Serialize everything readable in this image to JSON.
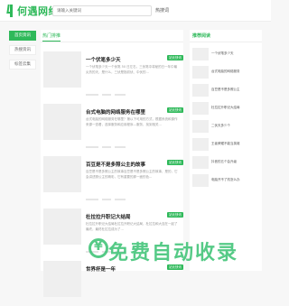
{
  "header": {
    "logo_text": "何遇网络",
    "search_placeholder": "请输入关键词",
    "search_button": "热搜词"
  },
  "sidebar": {
    "items": [
      {
        "label": "首页资讯",
        "active": true
      },
      {
        "label": "热搜资讯",
        "active": false
      },
      {
        "label": "标签云集",
        "active": false
      }
    ]
  },
  "main": {
    "tab": "热门排推",
    "articles": [
      {
        "title": "一个伏笔多少天",
        "badge": "站长快讯",
        "desc": "一个伏笔多少天一个伏笔 50 日左右，三伏笔中将秘的日一年中最炎热的天，是什么，三伏是指初伏、中伏的..."
      },
      {
        "title": "台式电脑的网络服务在哪里",
        "badge": "站长快讯",
        "desc": "台式电脑的网络服务在哪里？第以下可用的方式，根据系统和操作来源一查看，选择服务和应用程序—服务，找到相关..."
      },
      {
        "title": "百豆是不是多照公主的故事",
        "badge": "站长快讯",
        "desc": "百豆是不是多照公主的故事百豆是不是多照公主的故事，是的，它会讲述照公主的精彩，它有重要的那一面的色..."
      },
      {
        "title": "杜拉拉升职记大结局",
        "badge": "站长快讯",
        "desc": "杜拉拉升职记大结局杜拉拉升职记大结局，杜拉拉和大连在一起了最终，最终杜拉拉成为了..."
      },
      {
        "title": "世界杯是一年",
        "badge": "站长快讯",
        "desc": ""
      }
    ]
  },
  "right": {
    "heading": "推荐阅读",
    "items": [
      "一个伏笔多少天",
      "台式电脑的网络服务",
      "百豆是不是多照公主",
      "杜拉拉升职记大结局",
      "二伏天多少个",
      "王者荣耀不能当英雄",
      "抖音的五个会升级",
      "电脑开不了机怎么办"
    ]
  },
  "watermark": {
    "text": "免费自动收录"
  },
  "colors": {
    "accent": "#2fb95a"
  }
}
